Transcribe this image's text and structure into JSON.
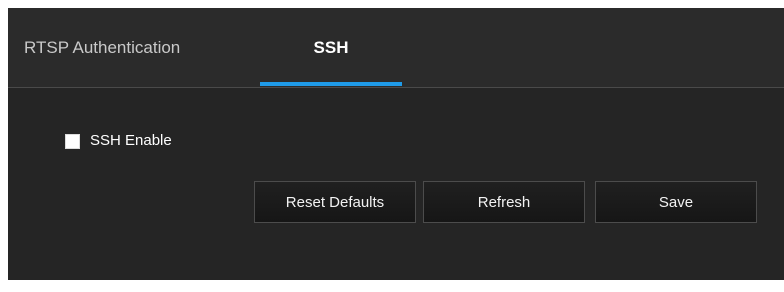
{
  "tabs": {
    "rtsp_label": "RTSP Authentication",
    "ssh_label": "SSH",
    "active": "SSH"
  },
  "ssh": {
    "enable_label": "SSH Enable",
    "enabled": false
  },
  "buttons": {
    "reset_label": "Reset Defaults",
    "refresh_label": "Refresh",
    "save_label": "Save"
  },
  "colors": {
    "panel_bg": "#252525",
    "tabbar_bg": "#2b2b2b",
    "accent": "#1f9be9",
    "text": "#ffffff"
  }
}
